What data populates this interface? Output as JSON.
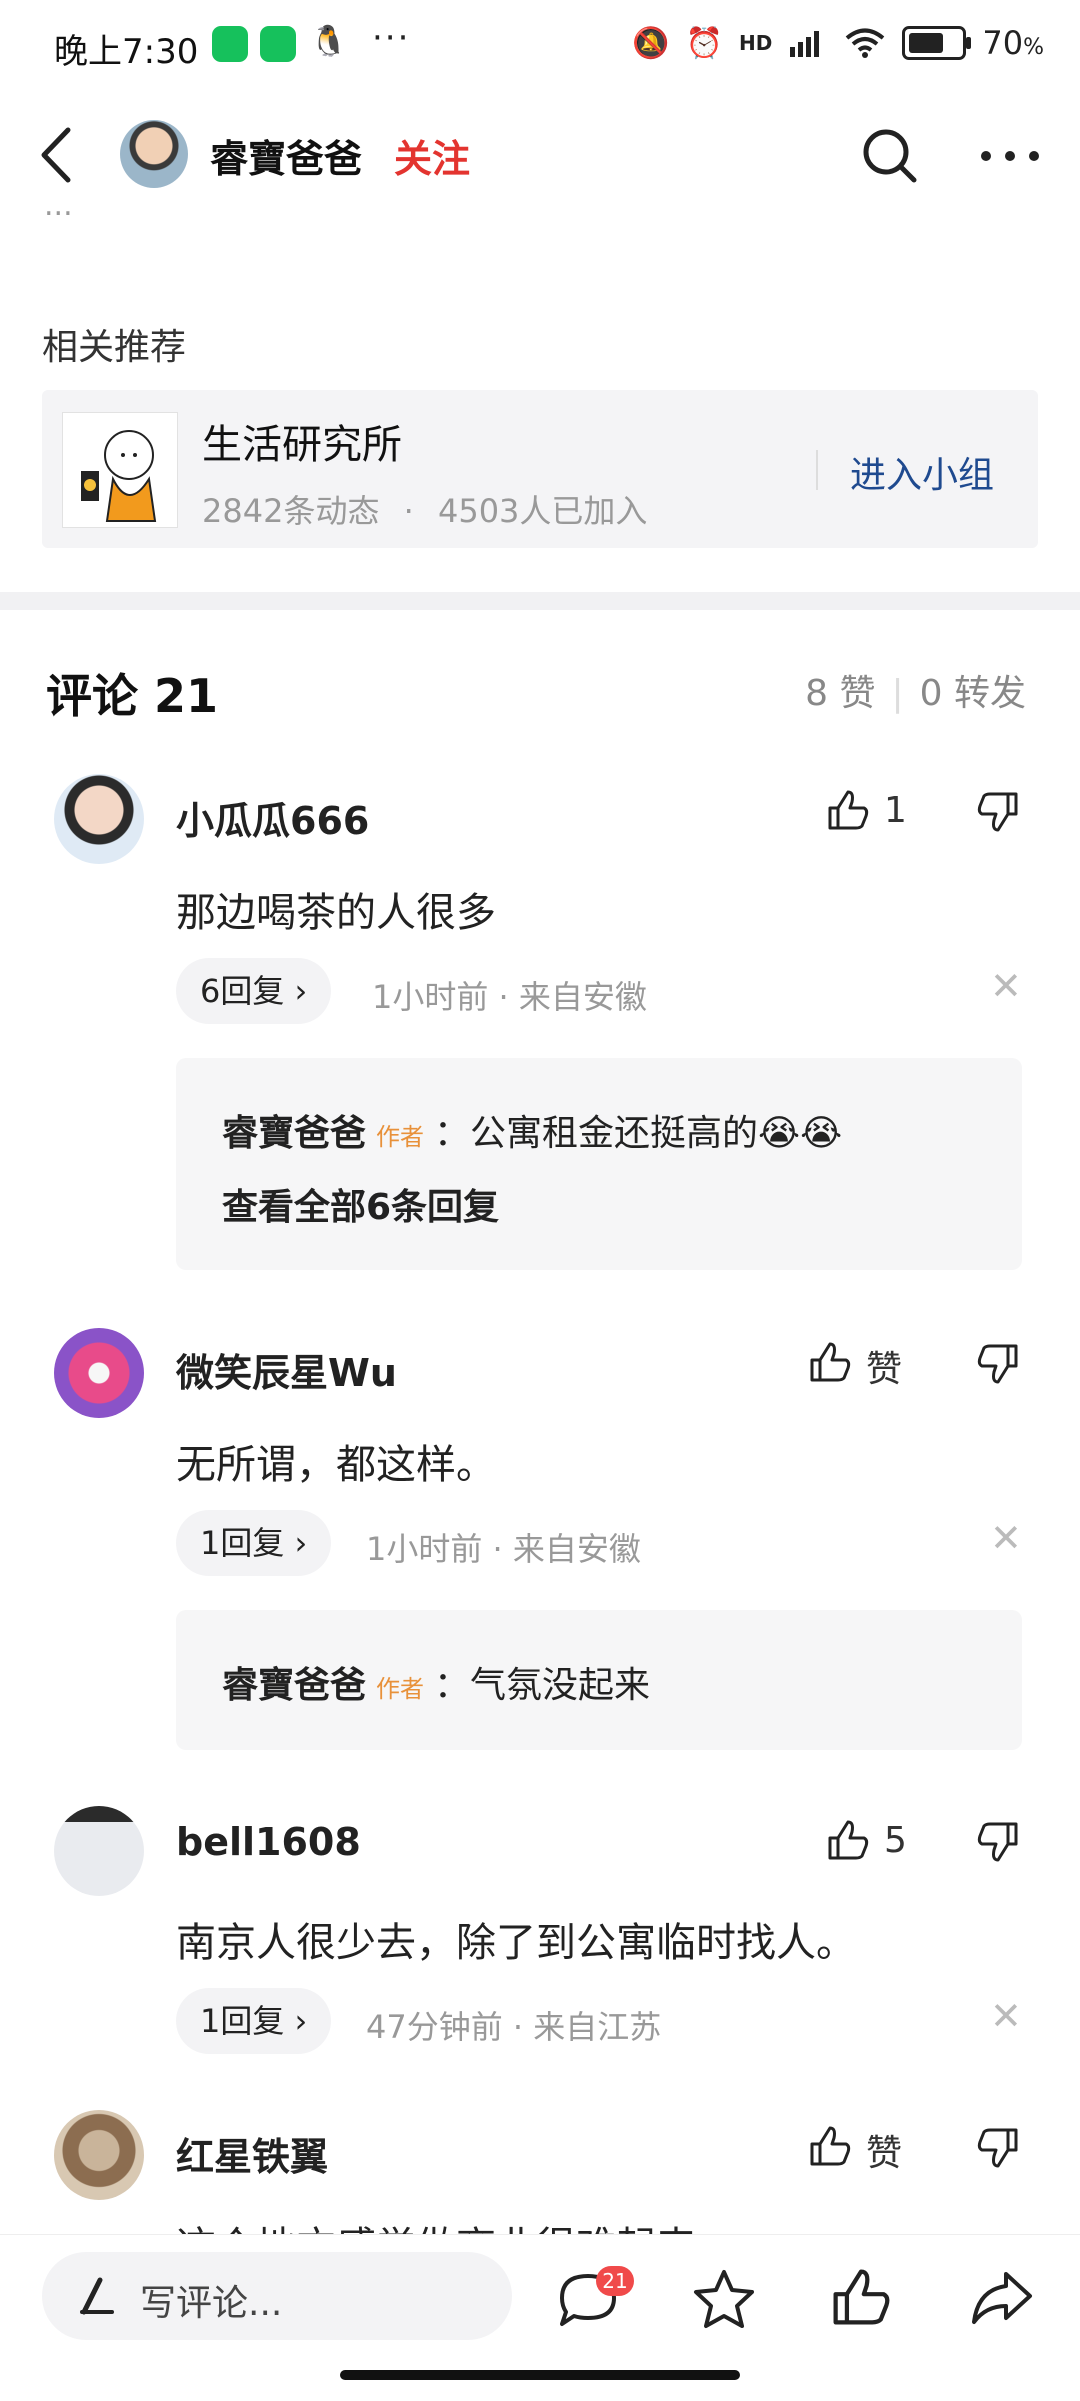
{
  "status_bar": {
    "time": "晚上7:30",
    "more": "···",
    "network": "HD",
    "battery": "70",
    "battery_unit": "%"
  },
  "header": {
    "author_name": "睿寶爸爸",
    "follow_label": "关注"
  },
  "partial_text": "...",
  "related": {
    "label": "相关推荐",
    "group_name": "生活研究所",
    "posts": "2842条动态",
    "dot": "·",
    "members": "4503人已加入",
    "join_label": "进入小组"
  },
  "comments_header": {
    "title": "评论 21",
    "likes": "8 赞",
    "reposts": "0 转发",
    "sep": "|"
  },
  "comments": [
    {
      "user": "小瓜瓜666",
      "like_label": "1",
      "text": "那边喝茶的人很多",
      "replies_label": "6回复",
      "time": "1小时前",
      "location": "来自安徽",
      "sub_reply": {
        "name": "睿寶爸爸",
        "tag": "作者",
        "text": "：公寓租金还挺高的😭😭",
        "more": "查看全部6条回复"
      }
    },
    {
      "user": "微笑辰星Wu",
      "like_label": "赞",
      "text": "无所谓，都这样。",
      "replies_label": "1回复",
      "time": "1小时前",
      "location": "来自安徽",
      "sub_reply": {
        "name": "睿寶爸爸",
        "tag": "作者",
        "text": "：气氛没起来"
      }
    },
    {
      "user": "bell1608",
      "like_label": "5",
      "text": "南京人很少去，除了到公寓临时找人。",
      "replies_label": "1回复",
      "time": "47分钟前",
      "location": "来自江苏"
    },
    {
      "user": "红星铁翼",
      "like_label": "赞",
      "text": "这个地方感觉做商业很难起来"
    }
  ],
  "bottom_bar": {
    "write_placeholder": "写评论...",
    "comment_count": "21"
  },
  "icons": {
    "back": "back-icon",
    "search": "search-icon",
    "more": "more-icon",
    "like": "thumbs-up-icon",
    "dislike": "thumbs-down-icon",
    "close": "close-icon",
    "chevron": "chevron-right-icon",
    "pen": "pen-icon",
    "comment": "comment-icon",
    "star": "star-icon",
    "share": "share-icon"
  },
  "colors": {
    "follow": "#e3342f",
    "join": "#1f4a8f",
    "author_tag": "#e8913a",
    "badge": "#f04a4a"
  }
}
